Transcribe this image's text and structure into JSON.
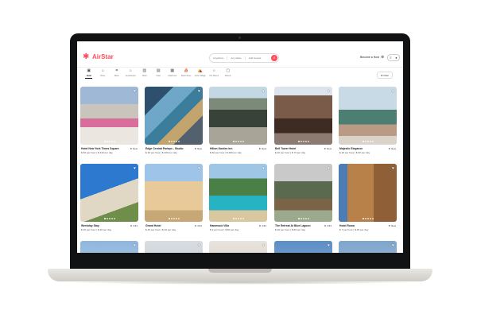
{
  "app": {
    "name": "AirStar",
    "brand_color": "#ff4b5c"
  },
  "search": {
    "segments": [
      "Anywhere",
      "Any dates",
      "Add Guests"
    ],
    "button_icon": "search-icon"
  },
  "header": {
    "host_label": "Become a Host",
    "globe_icon": "globe-icon",
    "menu_icon": "menu-icon",
    "avatar_icon": "user-icon"
  },
  "categories": {
    "items": [
      {
        "label": "Hotel",
        "icon": "hotel-icon",
        "active": true
      },
      {
        "label": "Home",
        "icon": "home-icon",
        "active": false
      },
      {
        "label": "Motel",
        "icon": "motel-icon",
        "active": false
      },
      {
        "label": "Guesthouse",
        "icon": "guesthouse-icon",
        "active": false
      },
      {
        "label": "Hotel",
        "icon": "building-icon",
        "active": false
      },
      {
        "label": "Suite",
        "icon": "suite-icon",
        "active": false
      },
      {
        "label": "Apartment",
        "icon": "apartment-icon",
        "active": false
      },
      {
        "label": "Boat House",
        "icon": "boat-icon",
        "active": false
      },
      {
        "label": "Arctic Village",
        "icon": "village-icon",
        "active": false
      },
      {
        "label": "Hot Places",
        "icon": "sun-icon",
        "active": false
      },
      {
        "label": "Rooms",
        "icon": "room-icon",
        "active": false
      }
    ],
    "filter_label": "Filter"
  },
  "listings": [
    {
      "title": "Hotel New York Times Square",
      "rating": "New",
      "price": "$ 50 per hour | $ 340 per day"
    },
    {
      "title": "Edge Central Parlays - Studio",
      "rating": "New",
      "price": "$ 30 per hour | $ 200 per day"
    },
    {
      "title": "Hilton Garden Inn",
      "rating": "New",
      "price": "$ 60 per hour | $ 480 per day"
    },
    {
      "title": "Bell Tower Hotel",
      "rating": "New",
      "price": "$ 40 per hour | $ 70 per day"
    },
    {
      "title": "Majestic Elegance",
      "rating": "New",
      "price": "$ 20 per hour | $ 80 per day"
    },
    {
      "title": "Weekday Stay",
      "rating": "4.81",
      "price": "$ 40 per hour | $ 20 per day"
    },
    {
      "title": "Grand Hotel",
      "rating": "4.81",
      "price": "$ 40 per hour | $ 20 per day"
    },
    {
      "title": "Hammock Villa",
      "rating": "4.81",
      "price": "$ 9 per hour | $ 60 per day"
    },
    {
      "title": "The Retreat At Blue Lagoon",
      "rating": "4.81",
      "price": "$ 20 per hour | $ 80 per day"
    },
    {
      "title": "Hotel Roma",
      "rating": "New",
      "price": "$ 7 per hour | $ 25 per day"
    }
  ]
}
